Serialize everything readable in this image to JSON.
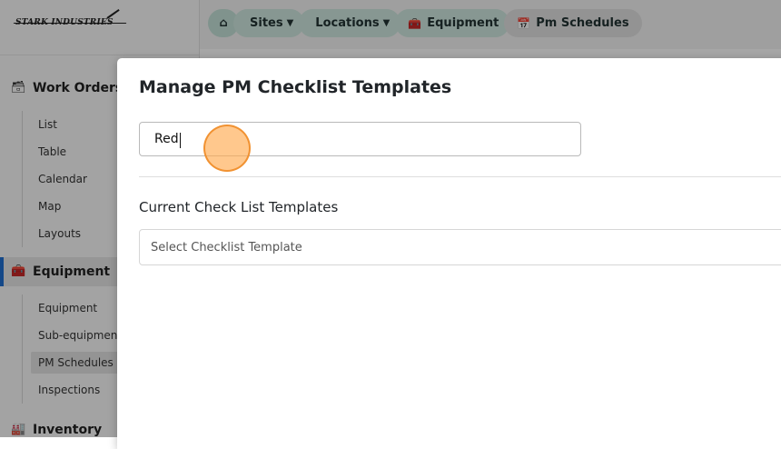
{
  "brand": {
    "logo_text": "STARK INDUSTRIES"
  },
  "sidebar": {
    "sections": [
      {
        "label": "Work Orders",
        "icon": "inbox-icon",
        "items": [
          "List",
          "Table",
          "Calendar",
          "Map",
          "Layouts"
        ]
      },
      {
        "label": "Equipment",
        "icon": "toolbox-icon",
        "items": [
          "Equipment",
          "Sub-equipment",
          "PM Schedules",
          "Inspections"
        ]
      },
      {
        "label": "Inventory",
        "icon": "warehouse-icon",
        "items": []
      }
    ],
    "active_section": "Equipment",
    "active_item": "PM Schedules"
  },
  "breadcrumb": {
    "items": [
      {
        "label": "",
        "icon": "home-icon"
      },
      {
        "label": "Sites",
        "dropdown": true
      },
      {
        "label": "Locations",
        "dropdown": true
      },
      {
        "label": "Equipment",
        "icon": "toolbox-icon"
      },
      {
        "label": "Pm Schedules",
        "icon": "calendar-gear-icon"
      }
    ]
  },
  "modal": {
    "title": "Manage PM Checklist Templates",
    "search_value": "Red",
    "current_label": "Current Check List Templates",
    "select_placeholder": "Select Checklist Template"
  },
  "colors": {
    "accent": "#1f6fd1",
    "breadcrumb": "#cfe8e0",
    "click_marker": "#f7a94f"
  }
}
